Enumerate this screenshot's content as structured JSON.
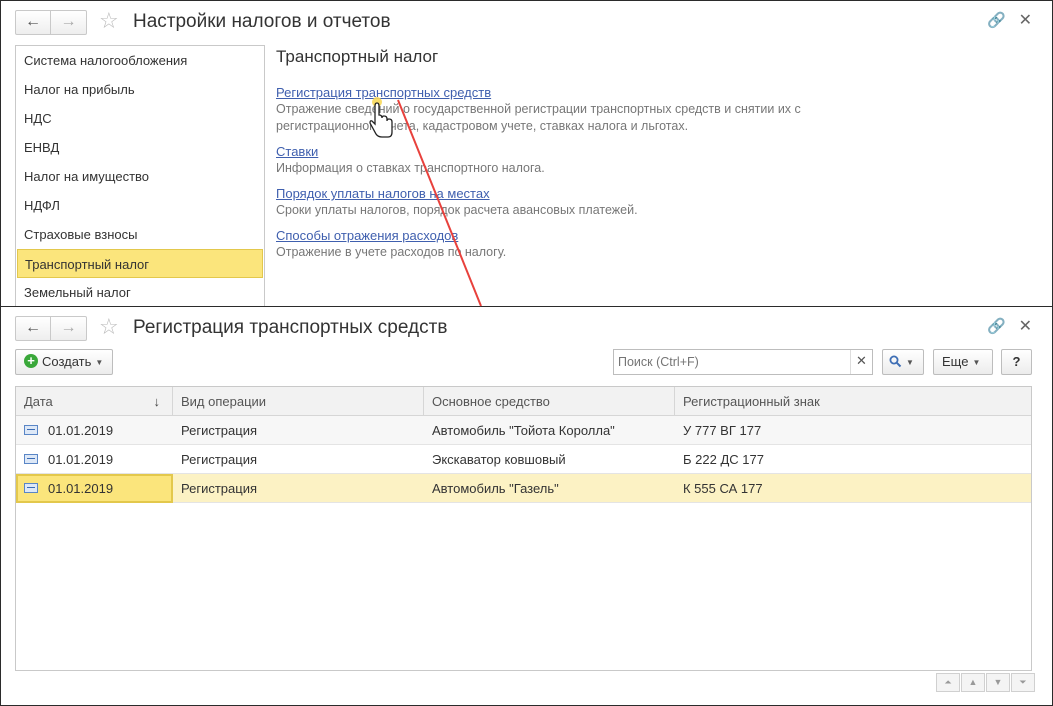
{
  "window1": {
    "title": "Настройки налогов и отчетов",
    "nav_back": "🡐",
    "nav_forward": "🡒",
    "sidebar": {
      "items": [
        {
          "label": "Система налогообложения"
        },
        {
          "label": "Налог на прибыль"
        },
        {
          "label": "НДС"
        },
        {
          "label": "ЕНВД"
        },
        {
          "label": "Налог на имущество"
        },
        {
          "label": "НДФЛ"
        },
        {
          "label": "Страховые взносы"
        },
        {
          "label": "Транспортный налог",
          "active": true
        },
        {
          "label": "Земельный налог"
        }
      ]
    },
    "content": {
      "title": "Транспортный налог",
      "sections": [
        {
          "link": "Регистрация транспортных средств",
          "desc": "Отражение сведений о государственной регистрации транспортных средств и снятии их с регистрационного учета, кадастровом учете, ставках налога и льготах."
        },
        {
          "link": "Ставки",
          "desc": "Информация о ставках транспортного налога."
        },
        {
          "link": "Порядок уплаты налогов на местах",
          "desc": "Сроки уплаты налогов, порядок расчета авансовых платежей."
        },
        {
          "link": "Способы отражения расходов",
          "desc": "Отражение в учете расходов по налогу."
        }
      ]
    }
  },
  "window2": {
    "title": "Регистрация транспортных средств",
    "toolbar": {
      "create_label": "Создать",
      "search_placeholder": "Поиск (Ctrl+F)",
      "more_label": "Еще",
      "help_label": "?"
    },
    "grid": {
      "columns": [
        "Дата",
        "Вид операции",
        "Основное средство",
        "Регистрационный знак"
      ],
      "sort_indicator": "↓",
      "rows": [
        {
          "date": "01.01.2019",
          "operation": "Регистрация",
          "asset": "Автомобиль \"Тойота Королла\"",
          "plate": "У 777 ВГ 177"
        },
        {
          "date": "01.01.2019",
          "operation": "Регистрация",
          "asset": "Экскаватор ковшовый",
          "plate": "Б 222 ДС 177"
        },
        {
          "date": "01.01.2019",
          "operation": "Регистрация",
          "asset": "Автомобиль \"Газель\"",
          "plate": "К 555 СА 177",
          "selected": true
        }
      ]
    }
  },
  "colors": {
    "accent_yellow": "#fbe57c",
    "selection_row": "#fcf2c4",
    "link_blue": "#3f5fae",
    "arrow_red": "#e8413c",
    "create_green": "#3aa83a"
  }
}
